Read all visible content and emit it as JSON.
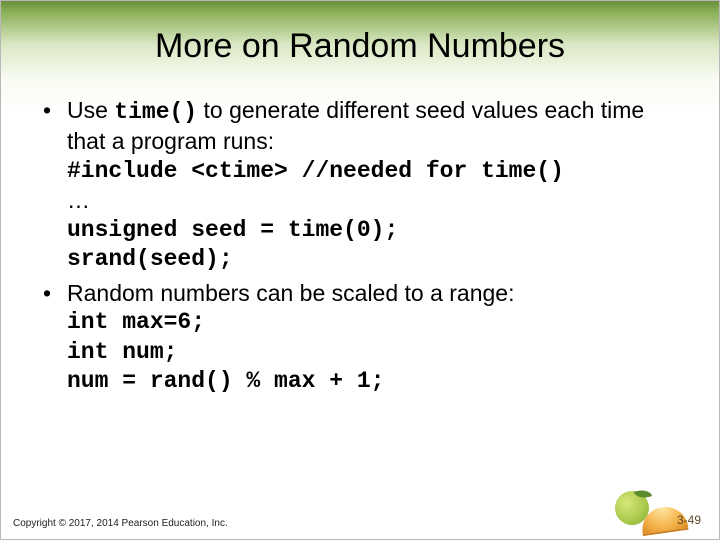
{
  "title": "More on Random Numbers",
  "bullets": [
    {
      "lead_a": "Use ",
      "code_inline": "time()",
      "lead_b": " to generate different seed values each time that a program runs:",
      "code_lines": [
        "#include <ctime> //needed for time()",
        "…",
        "unsigned seed = time(0);",
        "srand(seed);"
      ]
    },
    {
      "lead_a": "Random numbers can be scaled to a range:",
      "code_lines": [
        "int max=6;",
        "int num;",
        "num = rand() % max + 1;"
      ]
    }
  ],
  "footer": "Copyright © 2017, 2014 Pearson Education, Inc.",
  "page_number": "3-49"
}
